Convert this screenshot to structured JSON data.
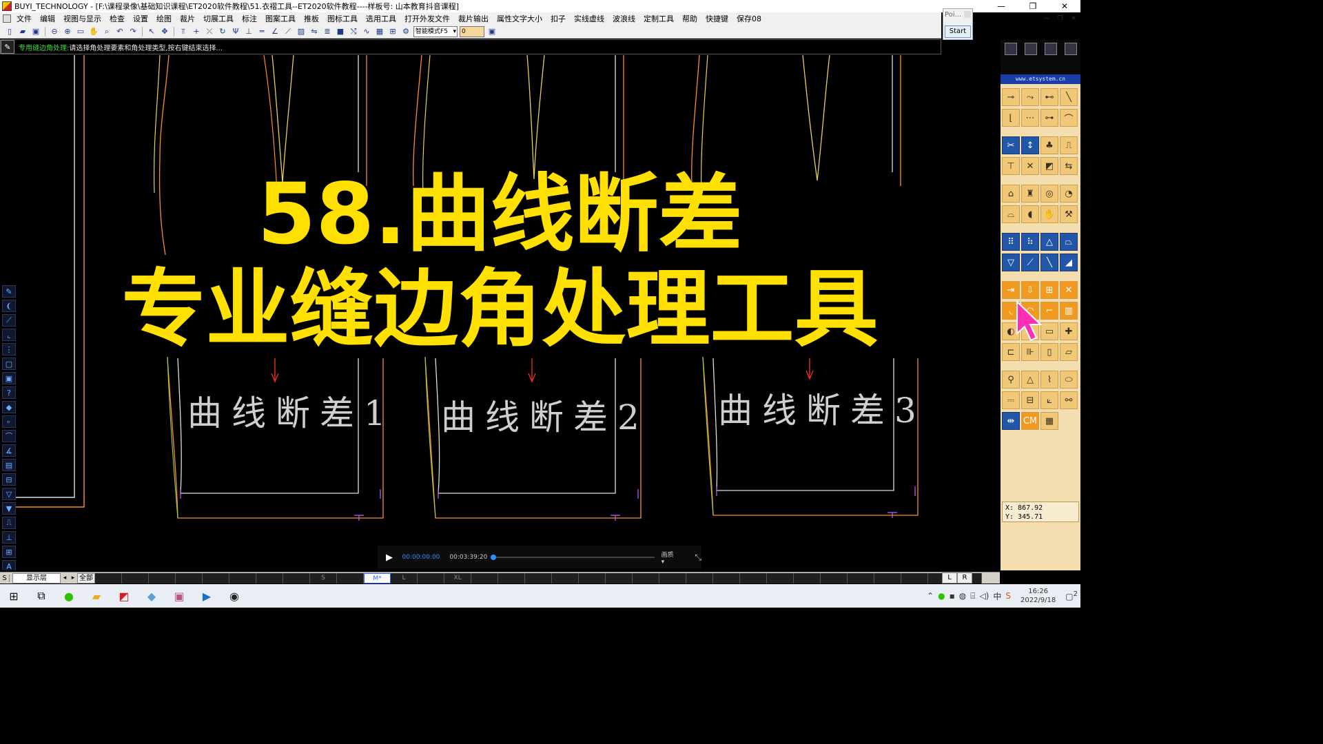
{
  "window": {
    "title": "BUYI_TECHNOLOGY - [F:\\课程录像\\基础知识课程\\ET2020软件教程\\51.衣褶工具--ET2020软件教程----样板号: 山本教育抖音课程]",
    "minimize": "—",
    "maximize": "❐",
    "close": "✕"
  },
  "menu": {
    "items": [
      "文件",
      "编辑",
      "视图与显示",
      "检查",
      "设置",
      "绘图",
      "裁片",
      "切展工具",
      "标注",
      "图案工具",
      "推板",
      "图标工具",
      "选用工具",
      "打开外发文件",
      "裁片输出",
      "属性文字大小",
      "扣子",
      "实线虚线",
      "波浪线",
      "定制工具",
      "帮助",
      "快捷键",
      "保存08"
    ]
  },
  "toolbar": {
    "mode_select": "智能模式F5",
    "value_input": "0"
  },
  "poi": {
    "label": "Poi...",
    "start_label": "Start"
  },
  "prompt": {
    "tool_name": "专用缝边角处理:",
    "message": "请选择角处理要素和角处理类型,按右键结束选择..."
  },
  "overlay": {
    "line1": "58.曲线断差",
    "line2": "专业缝边角处理工具"
  },
  "patterns": {
    "labels": [
      "曲线断差1",
      "曲线断差2",
      "曲线断差3"
    ]
  },
  "player": {
    "current_time": "00:00:00:00",
    "total_time": "00:03:39:20",
    "quality": "画质 ▾",
    "progress": 0
  },
  "sizebar": {
    "s_label": "S",
    "layer_label": "显示层",
    "all_label": "全部",
    "sizes": [
      "",
      "",
      "",
      "",
      "",
      "",
      "",
      "",
      "S",
      "",
      "M*",
      "L",
      "",
      "XL",
      "",
      "",
      "",
      "",
      "",
      "",
      "",
      "",
      "",
      "",
      "",
      "",
      "",
      "",
      "",
      "",
      "",
      "",
      ""
    ],
    "active_size": "M*",
    "l_btn": "L",
    "r_btn": "R"
  },
  "right_panel": {
    "logo_text": "www.etsystem.cn",
    "cm_label": "CM",
    "coord_x": "X:  867.92",
    "coord_y": "Y:  345.71"
  },
  "taskbar": {
    "time": "16:26",
    "date": "2022/9/18",
    "notif": "2"
  },
  "colors": {
    "title_yellow": "#ffe000",
    "curve_orange": "#ff8c30",
    "curve_yellow": "#e8d060",
    "arrow_red": "#e03020",
    "seam_green": "#9cd24a",
    "line_white": "#e0e0e0"
  }
}
